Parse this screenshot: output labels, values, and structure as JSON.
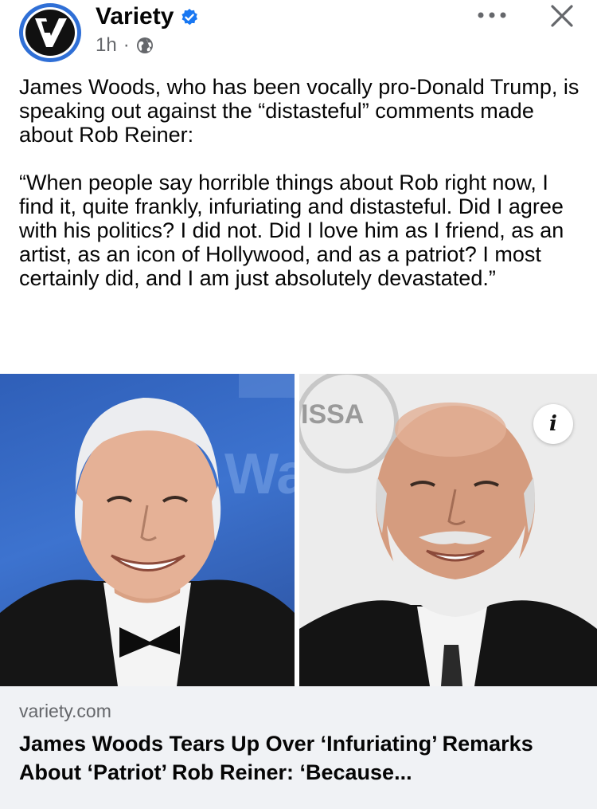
{
  "header": {
    "page_name": "Variety",
    "logo_letter": "V",
    "timestamp": "1h",
    "separator": "·",
    "audience_icon": "globe-icon",
    "verified_icon": "verified-badge-icon",
    "more_icon": "more-options-icon",
    "close_icon": "close-icon"
  },
  "post": {
    "paragraph_1": "James Woods, who has been vocally pro-Donald Trump, is speaking out against the “distasteful” comments made about Rob Reiner:",
    "paragraph_2": "“When people say horrible things about Rob right now, I find it, quite frankly, infuriating and distasteful. Did I agree with his politics? I did not. Did I love him as I friend, as an artist, as an icon of Hollywood, and as a patriot? I most certainly did, and I am just absolutely devastated.”"
  },
  "images": {
    "left_backdrop_text": "Wa",
    "right_backdrop_text": "ISSA",
    "info_button_label": "i"
  },
  "link_preview": {
    "domain": "variety.com",
    "headline": "James Woods Tears Up Over ‘Infuriating’ Remarks About ‘Patriot’ Rob Reiner: ‘Because..."
  },
  "colors": {
    "verified_blue": "#1877f2",
    "secondary_text": "#65676b",
    "card_background": "#f0f2f5",
    "avatar_ring": "#2f6fd6"
  }
}
